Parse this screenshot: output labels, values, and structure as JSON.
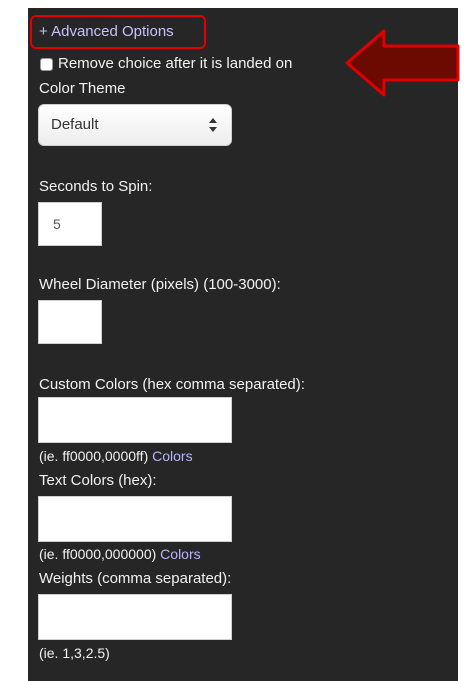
{
  "advanced": {
    "toggle_label": "+ Advanced Options"
  },
  "remove_choice": {
    "label": "Remove choice after it is landed on",
    "checked": false
  },
  "color_theme": {
    "label": "Color Theme",
    "selected": "Default"
  },
  "seconds_to_spin": {
    "label": "Seconds to Spin:",
    "value": "5"
  },
  "wheel_diameter": {
    "label": "Wheel Diameter (pixels) (100-3000):",
    "value": ""
  },
  "custom_colors": {
    "label": "Custom Colors (hex comma separated):",
    "value": "",
    "hint": "(ie. ff0000,0000ff)",
    "link": "Colors"
  },
  "text_colors": {
    "label": "Text Colors (hex):",
    "value": "",
    "hint": "(ie. ff0000,000000)",
    "link": "Colors"
  },
  "weights": {
    "label": "Weights (comma separated):",
    "value": "",
    "hint": "(ie. 1,3,2.5)"
  },
  "colors": {
    "panel_bg": "#262626",
    "highlight": "#e00000",
    "pointer_arrow": "#6b0a00",
    "link": "#b9b4ff"
  },
  "icons": [
    "select-arrows-icon",
    "pointer-arrow-icon"
  ]
}
